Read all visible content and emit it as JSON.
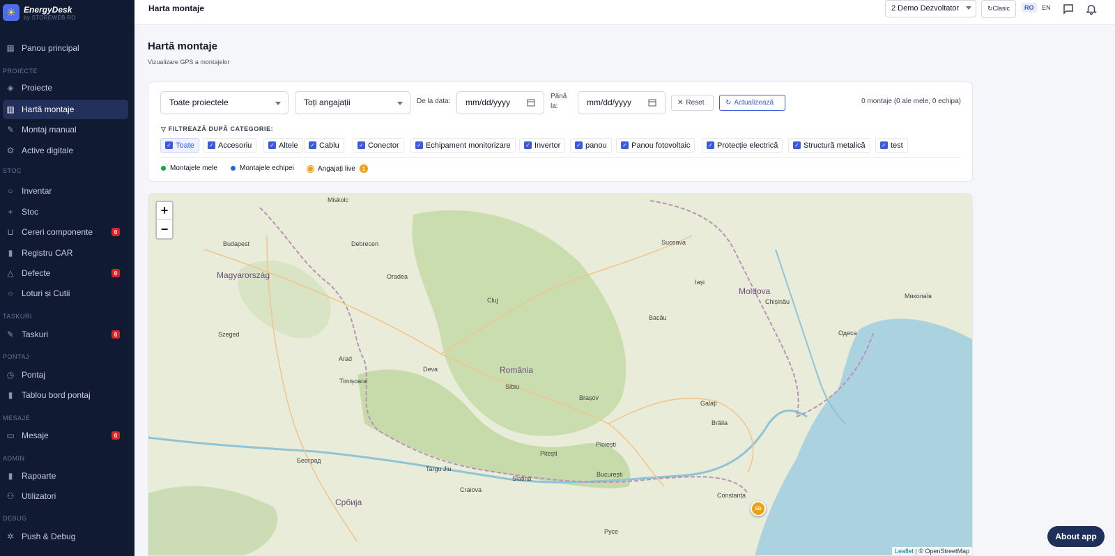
{
  "app": {
    "name": "EnergyDesk",
    "sub": "by STOREWEB.RO"
  },
  "sidebar": {
    "items": [
      {
        "label": "Panou principal"
      },
      {
        "label": "Proiecte"
      },
      {
        "label": "Hartă montaje"
      },
      {
        "label": "Montaj manual"
      },
      {
        "label": "Active digitale"
      },
      {
        "label": "Inventar"
      },
      {
        "label": "Stoc"
      },
      {
        "label": "Cereri componente",
        "badge": "0"
      },
      {
        "label": "Registru CAR"
      },
      {
        "label": "Defecte",
        "badge": "0"
      },
      {
        "label": "Loturi și Cutii"
      },
      {
        "label": "Taskuri",
        "badge": "0"
      },
      {
        "label": "Pontaj"
      },
      {
        "label": "Tablou bord pontaj"
      },
      {
        "label": "Mesaje",
        "badge": "0"
      },
      {
        "label": "Rapoarte"
      },
      {
        "label": "Utilizatori"
      },
      {
        "label": "Push & Debug"
      }
    ],
    "sections": [
      "PROIECTE",
      "STOC",
      "TASKURI",
      "PONTAJ",
      "MESAJE",
      "ADMIN",
      "DEBUG"
    ]
  },
  "topbar": {
    "title": "Harta montaje",
    "user_select": "2 Demo Dezvoltator",
    "clasic": "Clasic",
    "lang_ro": "RO",
    "lang_en": "EN"
  },
  "page": {
    "title": "Hartă montaje",
    "subtitle": "Vizualizare GPS a montajelor"
  },
  "filters": {
    "project_select": "Toate proiectele",
    "employee_select": "Toți angajații",
    "from_label": "De la data:",
    "to_label": "Până la:",
    "date_placeholder": "mm/dd/yyyy",
    "reset": "Reset",
    "refresh": "Actualizează",
    "count": "0 montaje (0 ale mele, 0 echipa)",
    "category_title": "FILTREAZĂ DUPĂ CATEGORIE:",
    "categories": [
      "Toate",
      "Accesoriu",
      "Altele",
      "Cablu",
      "Conector",
      "Echipament monitorizare",
      "Invertor",
      "panou",
      "Panou fotovoltaic",
      "Protecție electrică",
      "Structură metalică",
      "test"
    ]
  },
  "legend": {
    "mine": "Montajele mele",
    "team": "Montajele echipei",
    "live": "Angajați live",
    "live_count": "1"
  },
  "map": {
    "zoom_in": "+",
    "zoom_out": "−",
    "marker": "SD",
    "attribution_leaflet": "Leaflet",
    "attribution_osm": "| © OpenStreetMap",
    "labels": {
      "romania": "România",
      "magyarorszag": "Magyarország",
      "moldova": "Moldova",
      "budapest": "Budapest",
      "bucuresti": "București",
      "cluj": "Cluj",
      "brasov": "Brașov",
      "timisoara": "Timișoara",
      "iasi": "Iași",
      "galati": "Galați",
      "constanta": "Constanța",
      "odesa": "Одеса",
      "beograd": "Београд",
      "srbija": "Србија",
      "craiova": "Craiova",
      "sibiu": "Sibiu",
      "oradea": "Oradea",
      "ploiesti": "Ploiești",
      "suceava": "Suceava",
      "bacau": "Bacău",
      "pitesti": "Pitești",
      "arad": "Arad",
      "szeged": "Szeged",
      "debrecen": "Debrecen",
      "chisinau": "Chișinău",
      "miskolc": "Miskolc",
      "braila": "Brăila",
      "slatina": "Slatina",
      "deva": "Deva",
      "targu_jiu": "Targu Jiu",
      "ruse": "Русе",
      "mykolaiv": "Миколаїв"
    }
  }
}
